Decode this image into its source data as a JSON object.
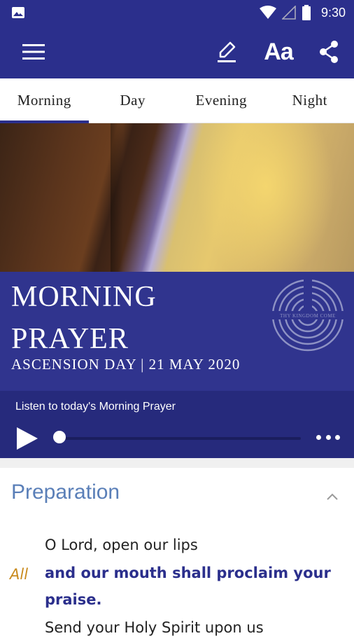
{
  "status": {
    "time": "9:30"
  },
  "tabs": [
    {
      "label": "Morning",
      "active": true
    },
    {
      "label": "Day",
      "active": false
    },
    {
      "label": "Evening",
      "active": false
    },
    {
      "label": "Night",
      "active": false
    }
  ],
  "appbar": {
    "font_label": "Aa"
  },
  "banner": {
    "title_line1": "MORNING",
    "title_line2": "PRAYER",
    "subtitle": "ASCENSION DAY | 21 MAY 2020",
    "logo_text": "THY KINGDOM COME"
  },
  "player": {
    "listen_label": "Listen to today's Morning Prayer",
    "progress": 0.0
  },
  "content": {
    "section_title": "Preparation",
    "line1": "O Lord, open our lips",
    "all_label": "All",
    "response_line1": "and our mouth shall proclaim your",
    "response_line2": "praise.",
    "line2": "Send your Holy Spirit upon us"
  },
  "colors": {
    "primary": "#2b2f8c",
    "accent": "#c98a1c",
    "section": "#5a7fb8"
  }
}
